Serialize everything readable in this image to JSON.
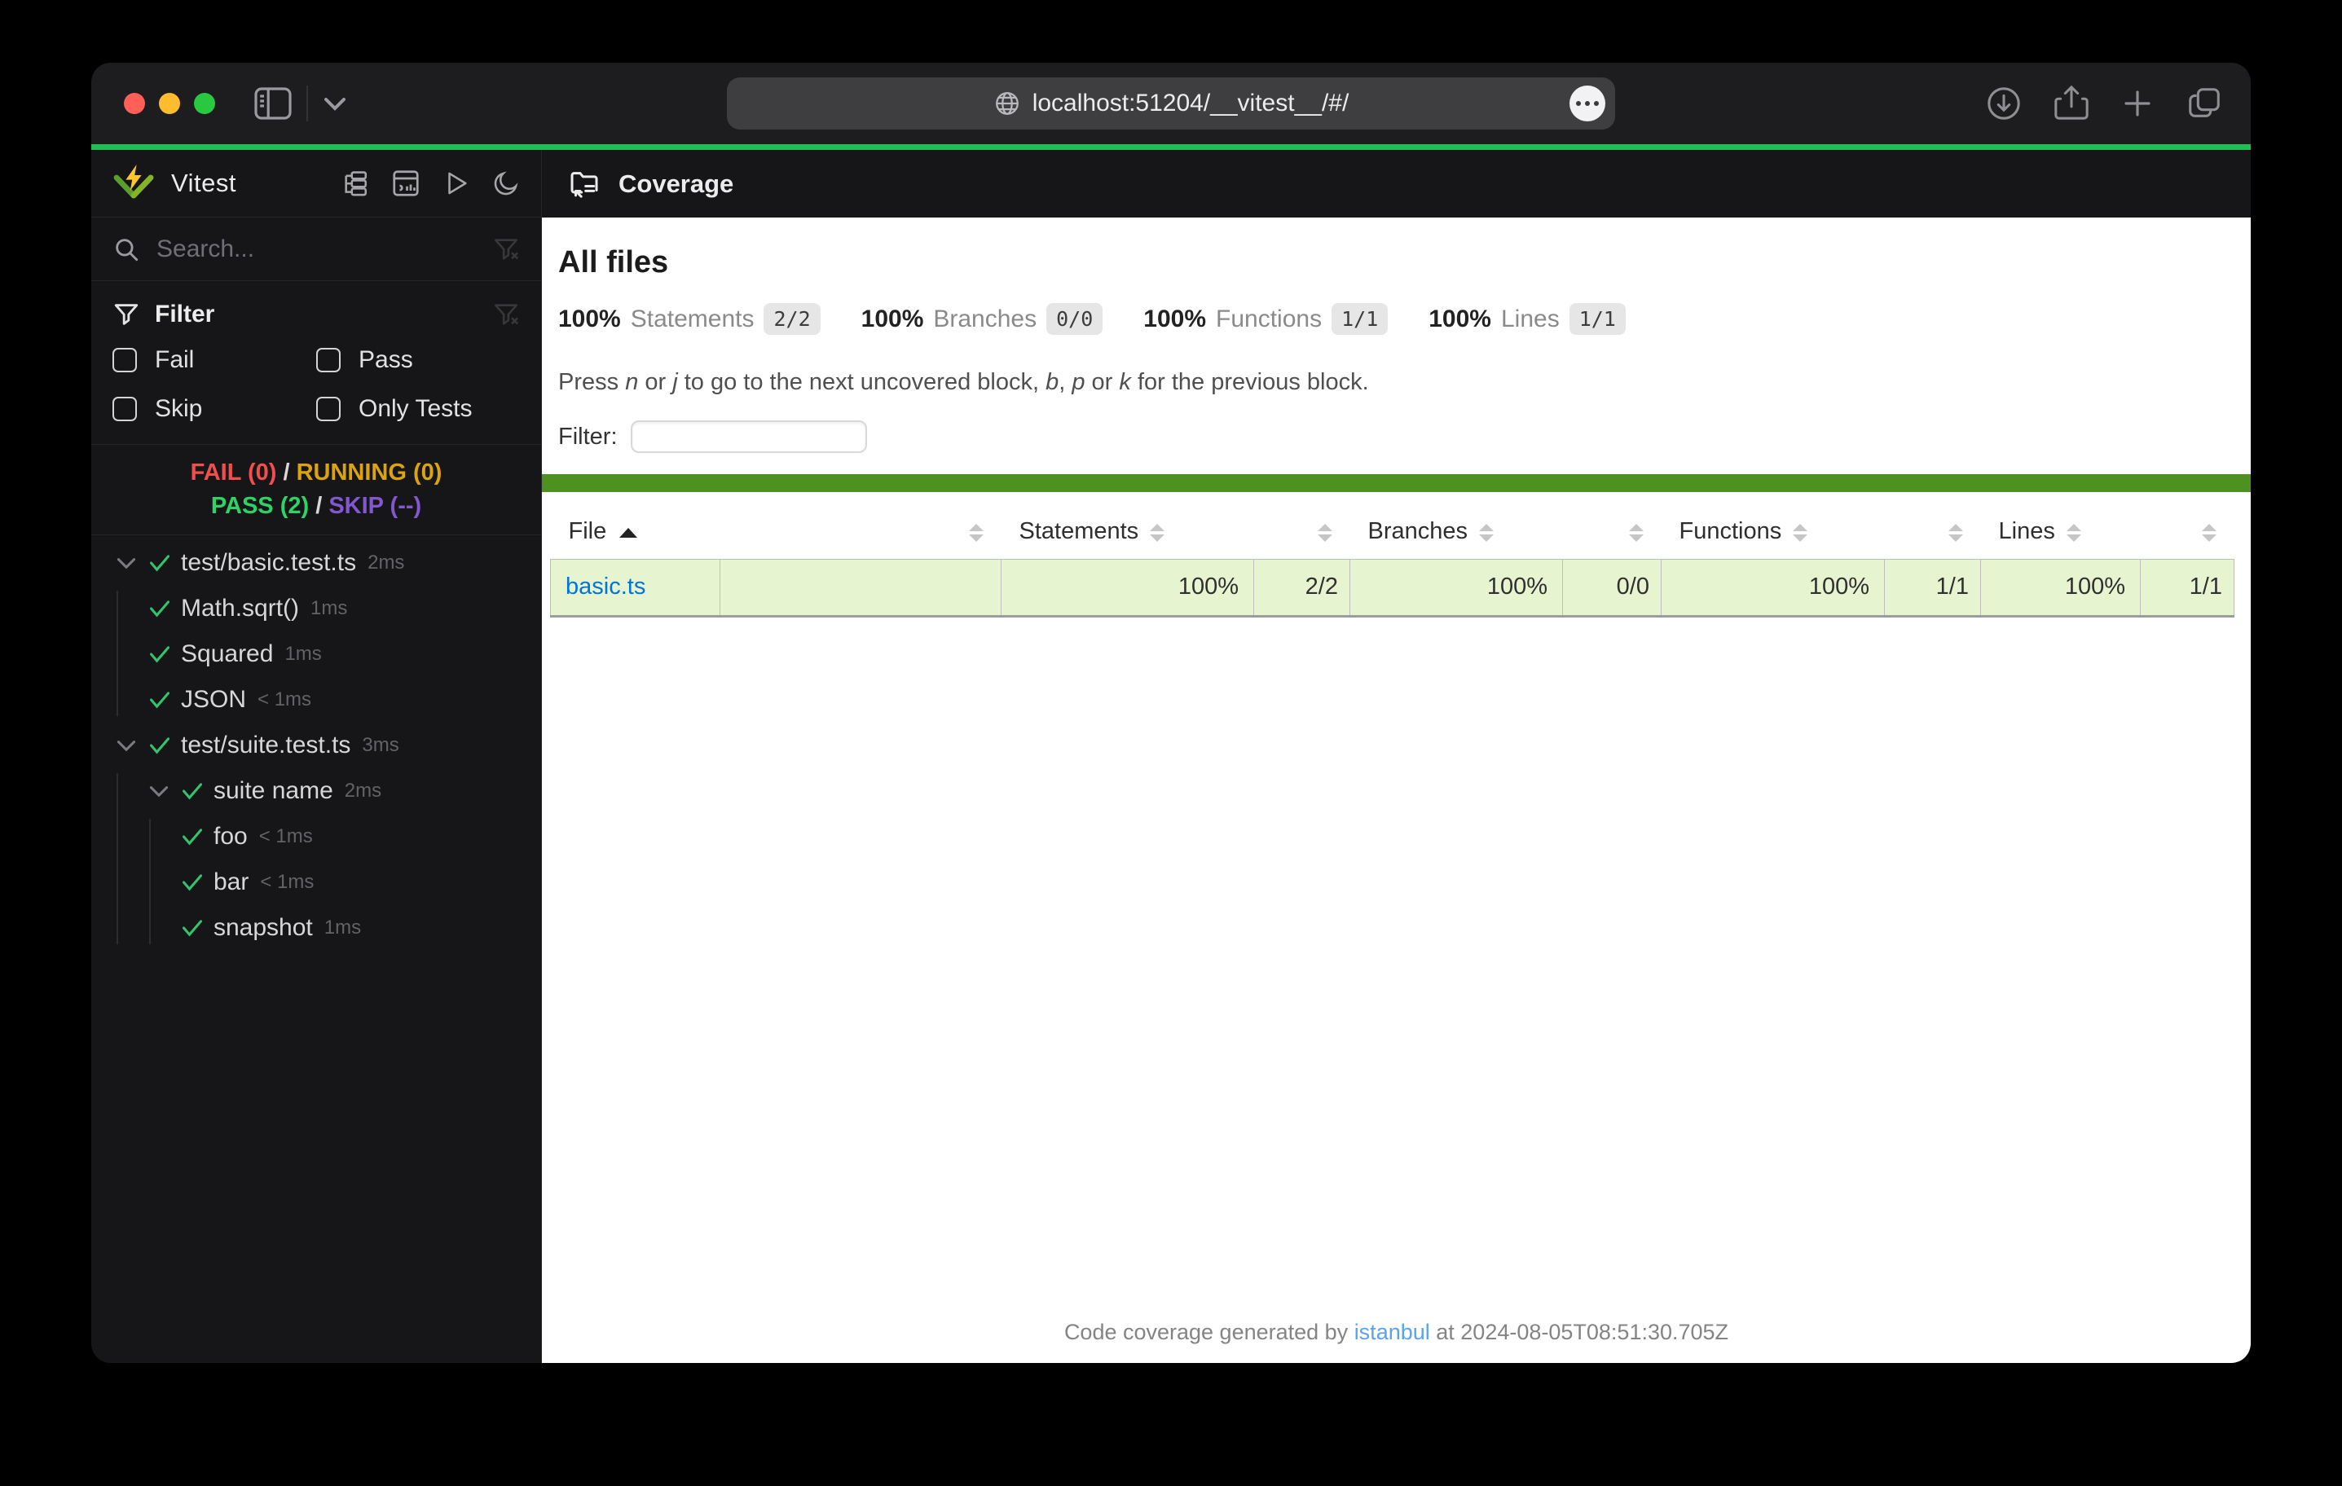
{
  "colors": {
    "accent_green": "#4d9221",
    "row_light_green": "#e6f5d0",
    "top_line_green": "#20bf55",
    "fail_red": "#f24e4e",
    "running_amber": "#dca310",
    "pass_green": "#2dd366",
    "skip_purple": "#8257d0",
    "link_blue": "#0074d9",
    "traffic_close": "#ff5f57",
    "traffic_minimize": "#febc2e",
    "traffic_zoom": "#28c840"
  },
  "browser": {
    "url": "localhost:51204/__vitest__/#/"
  },
  "sidebar": {
    "app_name": "Vitest",
    "search_placeholder": "Search...",
    "filter": {
      "title": "Filter",
      "checkboxes": [
        {
          "label": "Fail"
        },
        {
          "label": "Pass"
        },
        {
          "label": "Skip"
        },
        {
          "label": "Only Tests"
        }
      ]
    },
    "status": {
      "fail": "FAIL (0)",
      "sep1": "/",
      "running": "RUNNING (0)",
      "pass": "PASS (2)",
      "sep2": "/",
      "skip": "SKIP (--)"
    },
    "tree": [
      {
        "label": "test/basic.test.ts",
        "time": "2ms"
      },
      {
        "label": "Math.sqrt()",
        "time": "1ms"
      },
      {
        "label": "Squared",
        "time": "1ms"
      },
      {
        "label": "JSON",
        "time": "< 1ms"
      },
      {
        "label": "test/suite.test.ts",
        "time": "3ms"
      },
      {
        "label": "suite name",
        "time": "2ms"
      },
      {
        "label": "foo",
        "time": "< 1ms"
      },
      {
        "label": "bar",
        "time": "< 1ms"
      },
      {
        "label": "snapshot",
        "time": "1ms"
      }
    ]
  },
  "main": {
    "header_title": "Coverage",
    "all_files_heading": "All files",
    "summary": [
      {
        "pct": "100%",
        "label": "Statements",
        "frac": "2/2"
      },
      {
        "pct": "100%",
        "label": "Branches",
        "frac": "0/0"
      },
      {
        "pct": "100%",
        "label": "Functions",
        "frac": "1/1"
      },
      {
        "pct": "100%",
        "label": "Lines",
        "frac": "1/1"
      }
    ],
    "hint": {
      "p1": "Press ",
      "k1": "n",
      "p2": " or ",
      "k2": "j",
      "p3": " to go to the next uncovered block, ",
      "k3": "b",
      "p4": ", ",
      "k4": "p",
      "p5": " or ",
      "k5": "k",
      "p6": " for the previous block."
    },
    "filter_label": "Filter:",
    "table": {
      "columns": {
        "file": "File",
        "statements": "Statements",
        "branches": "Branches",
        "functions": "Functions",
        "lines": "Lines"
      },
      "rows": [
        {
          "file": "basic.ts",
          "statements_pct": "100%",
          "statements_frac": "2/2",
          "branches_pct": "100%",
          "branches_frac": "0/0",
          "functions_pct": "100%",
          "functions_frac": "1/1",
          "lines_pct": "100%",
          "lines_frac": "1/1",
          "bar_pct": 100
        }
      ]
    },
    "footer": {
      "prefix": "Code coverage generated by ",
      "link": "istanbul",
      "suffix": " at 2024-08-05T08:51:30.705Z"
    }
  }
}
